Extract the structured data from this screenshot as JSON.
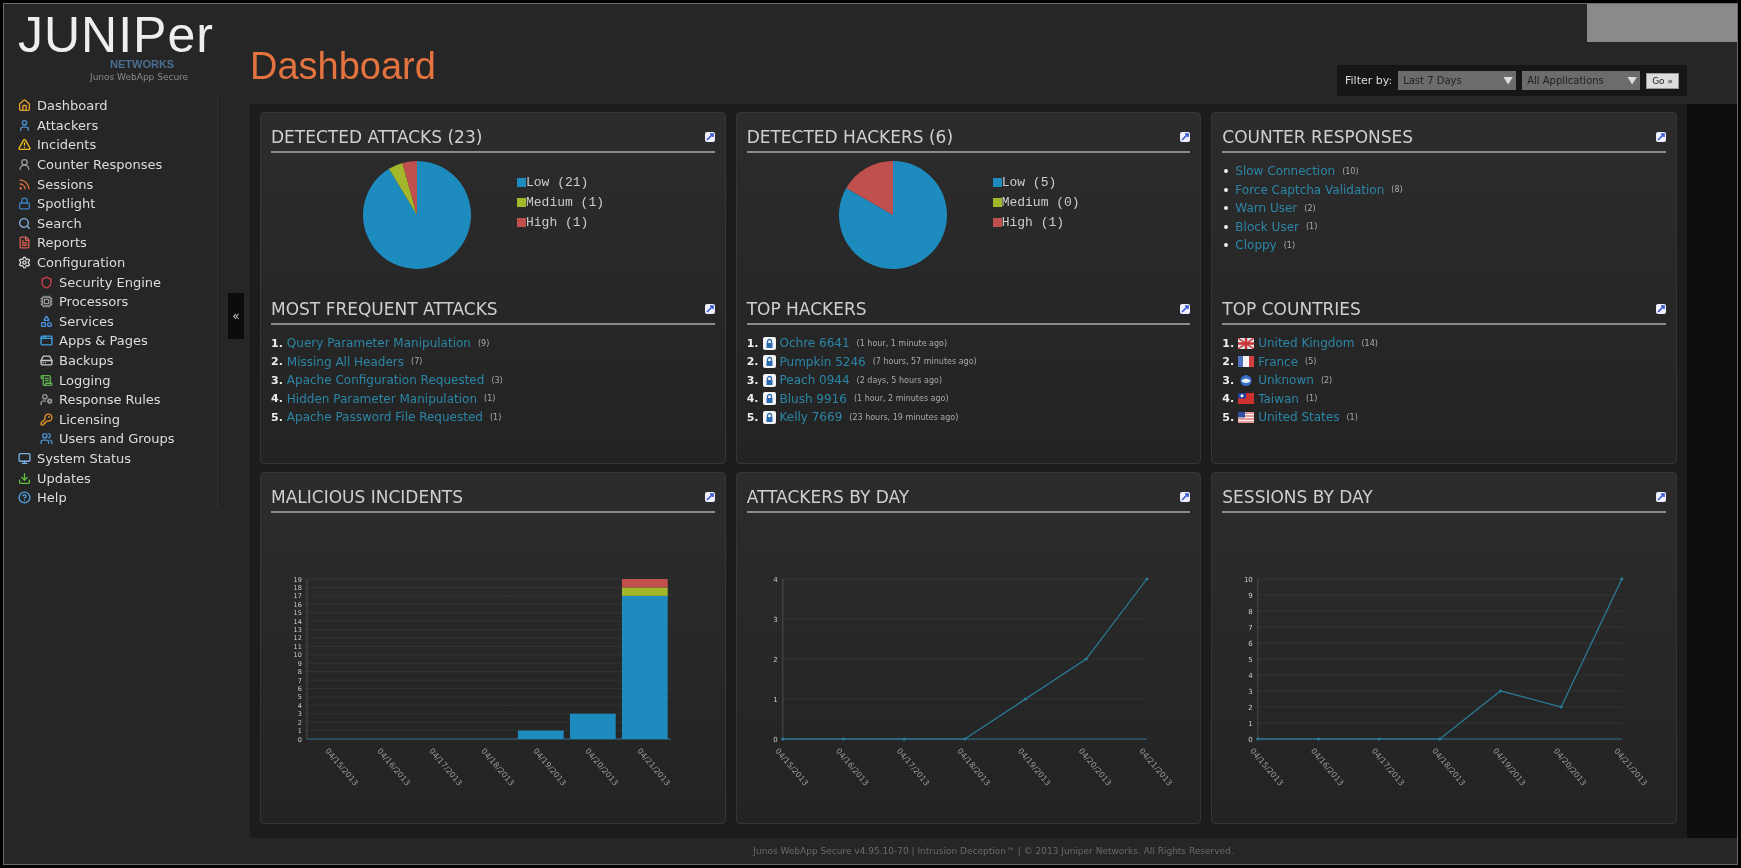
{
  "brand": {
    "logo": "JUNIPer",
    "sub": "NETWORKS",
    "product": "Junos WebApp Secure"
  },
  "sidebar": {
    "collapse": "«",
    "items": [
      {
        "label": "Dashboard"
      },
      {
        "label": "Attackers"
      },
      {
        "label": "Incidents"
      },
      {
        "label": "Counter Responses"
      },
      {
        "label": "Sessions"
      },
      {
        "label": "Spotlight"
      },
      {
        "label": "Search"
      },
      {
        "label": "Reports"
      },
      {
        "label": "Configuration",
        "children": [
          {
            "label": "Security Engine"
          },
          {
            "label": "Processors"
          },
          {
            "label": "Services"
          },
          {
            "label": "Apps & Pages"
          },
          {
            "label": "Backups"
          },
          {
            "label": "Logging"
          },
          {
            "label": "Response Rules"
          },
          {
            "label": "Licensing"
          },
          {
            "label": "Users and Groups"
          }
        ]
      },
      {
        "label": "System Status"
      },
      {
        "label": "Updates"
      },
      {
        "label": "Help"
      }
    ]
  },
  "header": {
    "title": "Dashboard",
    "filter": {
      "label": "Filter by:",
      "period": "Last 7 Days",
      "application": "All Applications",
      "go": "Go »"
    }
  },
  "top_panels": [
    {
      "sections": [
        {
          "kind": "chart",
          "title": "DETECTED ATTACKS (23)",
          "legend": [
            {
              "color": "#1e8bbf"
            },
            {
              "color": "#a3b72a"
            },
            {
              "color": "#c0504d"
            }
          ],
          "chart_data": {
            "type": "pie",
            "categories": [
              "Low (21)",
              "Medium (1)",
              "High (1)"
            ],
            "values": [
              21,
              1,
              1
            ]
          }
        },
        {
          "kind": "ranked",
          "title": "MOST FREQUENT ATTACKS",
          "items": [
            {
              "rank": "1.",
              "label": "Query Parameter Manipulation",
              "note": "(9)"
            },
            {
              "rank": "2.",
              "label": "Missing All Headers",
              "note": "(7)"
            },
            {
              "rank": "3.",
              "label": "Apache Configuration Requested",
              "note": "(3)"
            },
            {
              "rank": "4.",
              "label": "Hidden Parameter Manipulation",
              "note": "(1)"
            },
            {
              "rank": "5.",
              "label": "Apache Password File Requested",
              "note": "(1)"
            }
          ]
        }
      ]
    },
    {
      "sections": [
        {
          "kind": "chart",
          "title": "DETECTED HACKERS (6)",
          "legend": [
            {
              "color": "#1e8bbf"
            },
            {
              "color": "#a3b72a"
            },
            {
              "color": "#c0504d"
            }
          ],
          "chart_data": {
            "type": "pie",
            "categories": [
              "Low (5)",
              "Medium (0)",
              "High (1)"
            ],
            "values": [
              5,
              0,
              1
            ]
          }
        },
        {
          "kind": "ranked-user",
          "title": "TOP HACKERS",
          "items": [
            {
              "rank": "1.",
              "label": "Ochre 6641",
              "note": "(1 hour, 1 minute ago)"
            },
            {
              "rank": "2.",
              "label": "Pumpkin 5246",
              "note": "(7 hours, 57 minutes ago)"
            },
            {
              "rank": "3.",
              "label": "Peach 0944",
              "note": "(2 days, 5 hours ago)"
            },
            {
              "rank": "4.",
              "label": "Blush 9916",
              "note": "(1 hour, 2 minutes ago)"
            },
            {
              "rank": "5.",
              "label": "Kelly 7669",
              "note": "(23 hours, 19 minutes ago)"
            }
          ]
        }
      ]
    },
    {
      "sections": [
        {
          "kind": "bulleted",
          "title": "COUNTER RESPONSES",
          "items": [
            {
              "label": "Slow Connection",
              "note": "(10)"
            },
            {
              "label": "Force Captcha Validation",
              "note": "(8)"
            },
            {
              "label": "Warn User",
              "note": "(2)"
            },
            {
              "label": "Block User",
              "note": "(1)"
            },
            {
              "label": "Cloppy",
              "note": "(1)"
            }
          ]
        },
        {
          "kind": "ranked-country",
          "title": "TOP COUNTRIES",
          "items": [
            {
              "rank": "1.",
              "label": "United Kingdom",
              "note": "(14)"
            },
            {
              "rank": "2.",
              "label": "France",
              "note": "(5)"
            },
            {
              "rank": "3.",
              "label": "Unknown",
              "note": "(2)"
            },
            {
              "rank": "4.",
              "label": "Taiwan",
              "note": "(1)"
            },
            {
              "rank": "5.",
              "label": "United States",
              "note": "(1)"
            }
          ]
        }
      ]
    }
  ],
  "chart_panels": [
    {
      "title": "MALICIOUS INCIDENTS",
      "chart_data": {
        "type": "bar",
        "stacked": true,
        "categories": [
          "04/15/2013",
          "04/16/2013",
          "04/17/2013",
          "04/18/2013",
          "04/19/2013",
          "04/20/2013",
          "04/21/2013"
        ],
        "series": [
          {
            "color": "#1e8bbf",
            "values": [
              0,
              0,
              0,
              0,
              1,
              3,
              17
            ]
          },
          {
            "color": "#a3b72a",
            "values": [
              0,
              0,
              0,
              0,
              0,
              0,
              1
            ]
          },
          {
            "color": "#c0504d",
            "values": [
              0,
              0,
              0,
              0,
              0,
              0,
              1
            ]
          }
        ],
        "grid": true,
        "ylim": [
          0,
          19
        ],
        "yticks": [
          0,
          1,
          2,
          3,
          4,
          5,
          6,
          7,
          8,
          9,
          10,
          11,
          12,
          13,
          14,
          15,
          16,
          17,
          18,
          19
        ]
      }
    },
    {
      "title": "ATTACKERS BY DAY",
      "chart_data": {
        "type": "line",
        "categories": [
          "04/15/2013",
          "04/16/2013",
          "04/17/2013",
          "04/18/2013",
          "04/19/2013",
          "04/20/2013",
          "04/21/2013"
        ],
        "series": [
          {
            "color": "#2a7f9c",
            "values": [
              0,
              0,
              0,
              0,
              1,
              2,
              4
            ]
          }
        ],
        "grid": true,
        "ylim": [
          0,
          4
        ],
        "yticks": [
          0,
          1,
          2,
          3,
          4
        ]
      }
    },
    {
      "title": "SESSIONS BY DAY",
      "chart_data": {
        "type": "line",
        "categories": [
          "04/15/2013",
          "04/16/2013",
          "04/17/2013",
          "04/18/2013",
          "04/19/2013",
          "04/20/2013",
          "04/21/2013"
        ],
        "series": [
          {
            "color": "#2a7f9c",
            "values": [
              0,
              0,
              0,
              0,
              3,
              2,
              10
            ]
          }
        ],
        "grid": true,
        "ylim": [
          0,
          10
        ],
        "yticks": [
          0,
          1,
          2,
          3,
          4,
          5,
          6,
          7,
          8,
          9,
          10
        ]
      }
    }
  ],
  "footer": "Junos WebApp Secure v4.95.10-70 | Intrusion Deception™ | © 2013 Juniper Networks. All Rights Reserved."
}
